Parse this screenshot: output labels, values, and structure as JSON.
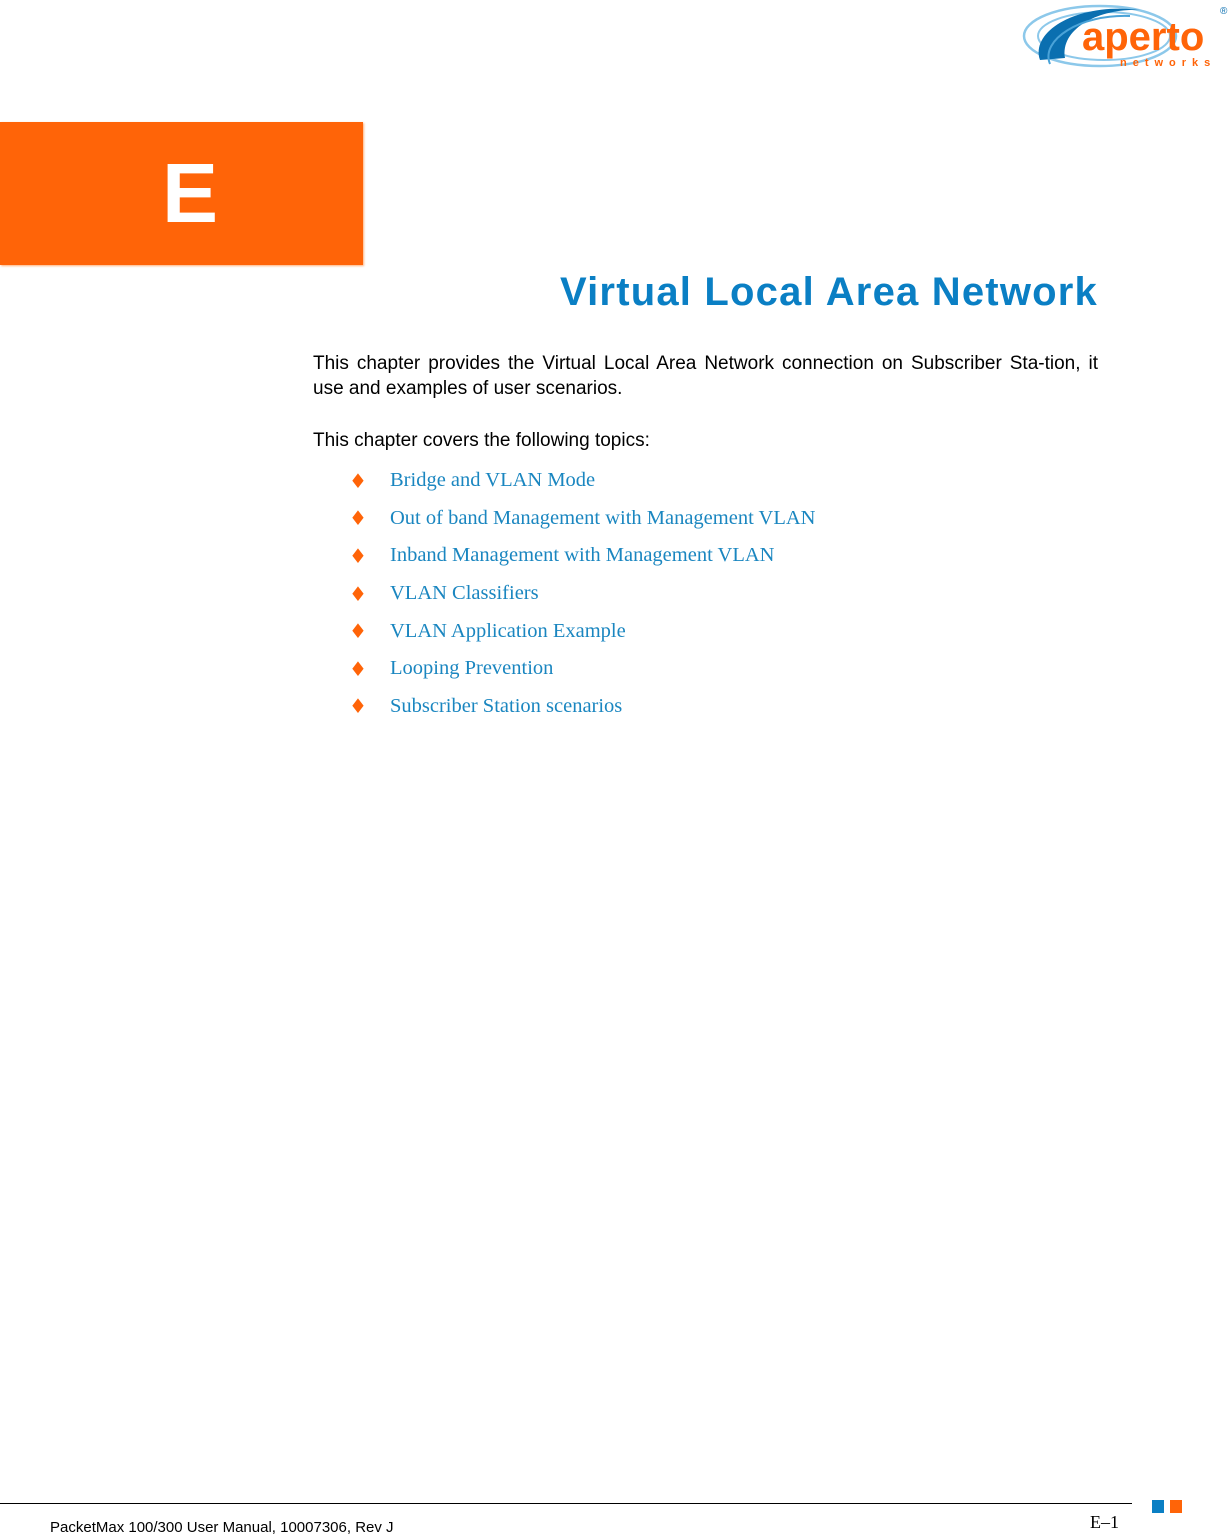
{
  "logo": {
    "brand": "aperto",
    "sub": "networks",
    "registered": "®",
    "colors": {
      "orange": "#ff6408",
      "blue": "#0a6fb0",
      "light_blue": "#8cc8ea"
    }
  },
  "chapter": {
    "letter": "E",
    "title": "Virtual Local Area Network"
  },
  "body": {
    "intro": "This chapter provides the Virtual Local Area Network connection on Subscriber Sta-tion, it use and examples of user scenarios.",
    "covers": "This chapter covers the following topics:",
    "bullet_icon": "♦",
    "topics": [
      {
        "label": "Bridge and VLAN Mode"
      },
      {
        "label": "Out of band Management with Management VLAN"
      },
      {
        "label": "Inband Management with Management VLAN"
      },
      {
        "label": "VLAN Classifiers"
      },
      {
        "label": "VLAN Application Example"
      },
      {
        "label": "Looping Prevention"
      },
      {
        "label": "Subscriber Station scenarios"
      }
    ]
  },
  "footer": {
    "document": "PacketMax 100/300 User Manual, 10007306, Rev J",
    "page": "E–1"
  },
  "colors": {
    "accent_orange": "#ff6408",
    "accent_blue": "#0a7fc4",
    "link_blue": "#1a86c0"
  }
}
